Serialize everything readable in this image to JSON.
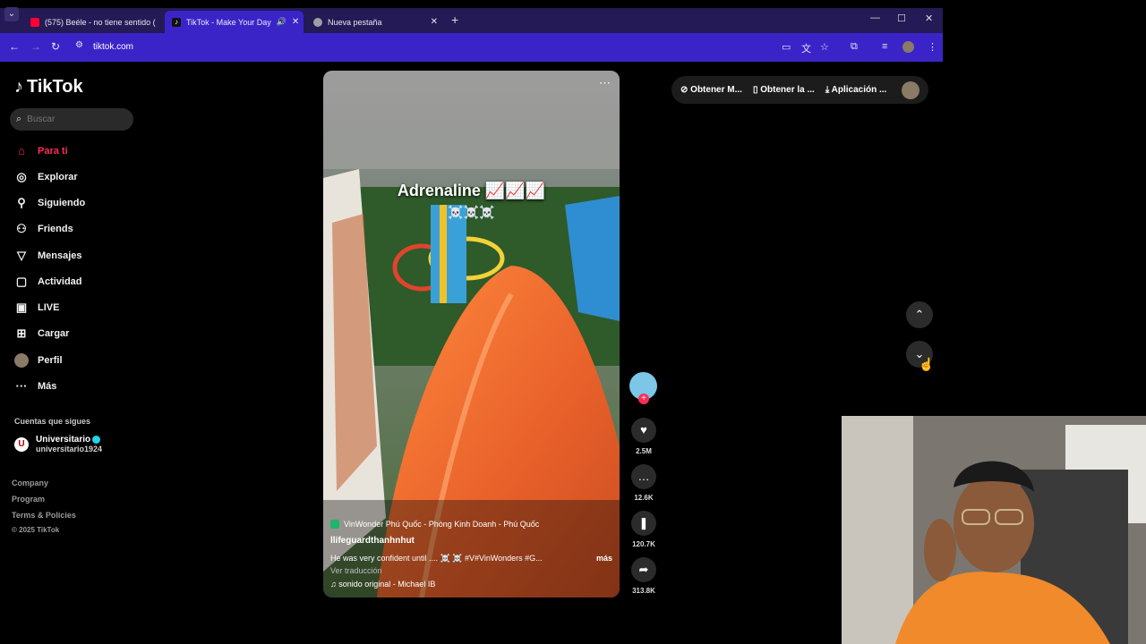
{
  "browser": {
    "tabs": [
      {
        "title": "(575) Beéle - no tiene sentido (",
        "icon": "youtube-icon"
      },
      {
        "title": "TikTok - Make Your Day",
        "icon": "tiktok-icon"
      },
      {
        "title": "Nueva pestaña",
        "icon": "chrome-icon"
      }
    ],
    "url": "tiktok.com"
  },
  "sidebar": {
    "logo": "TikTok",
    "search_placeholder": "Buscar",
    "nav": [
      {
        "label": "Para ti",
        "icon": "home-icon",
        "active": true
      },
      {
        "label": "Explorar",
        "icon": "compass-icon"
      },
      {
        "label": "Siguiendo",
        "icon": "following-icon"
      },
      {
        "label": "Friends",
        "icon": "friends-icon"
      },
      {
        "label": "Mensajes",
        "icon": "messages-icon"
      },
      {
        "label": "Actividad",
        "icon": "activity-icon"
      },
      {
        "label": "LIVE",
        "icon": "live-icon"
      },
      {
        "label": "Cargar",
        "icon": "upload-icon"
      },
      {
        "label": "Perfil",
        "icon": "profile-avatar"
      },
      {
        "label": "Más",
        "icon": "more-icon"
      }
    ],
    "following_header": "Cuentas que sigues",
    "following": [
      {
        "name": "Universitario",
        "handle": "universitario1924"
      }
    ],
    "footer": [
      "Company",
      "Program",
      "Terms & Policies",
      "© 2025 TikTok"
    ]
  },
  "topbar": {
    "items": [
      "Obtener M...",
      "Obtener la ...",
      "Aplicación ..."
    ]
  },
  "video": {
    "caption": "Adrenaline 📈📈📈",
    "caption_line2": "☠️☠️☠️",
    "location": "VinWonder Phú Quốc - Phòng Kinh Doanh - Phú Quốc",
    "author": "llifeguardthanhnhut",
    "description": "He was very confident until .... ☠️ ☠️   #V#VinWonders #G...",
    "more": "más",
    "translate": "Ver traducción",
    "sound": "sonido original - Michael IB"
  },
  "actions": {
    "likes": "2.5M",
    "comments": "12.6K",
    "saves": "120.7K",
    "shares": "313.8K"
  }
}
